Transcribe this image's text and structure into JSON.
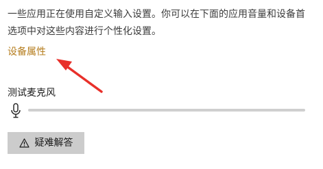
{
  "description": "一些应用正在使用自定义输入设置。你可以在下面的应用音量和设备首选项中对这些内容进行个性化设置。",
  "device_properties_link": "设备属性",
  "microphone_test": {
    "label": "测试麦克风",
    "level": 0,
    "icon": "microphone-icon"
  },
  "troubleshoot_button": {
    "label": "疑难解答",
    "icon": "warning-icon"
  },
  "annotation": {
    "icon": "red-arrow",
    "color": "#e8302a"
  },
  "colors": {
    "link": "#b57d1e",
    "button_bg": "#cccccc",
    "track": "#cfcfcf"
  }
}
